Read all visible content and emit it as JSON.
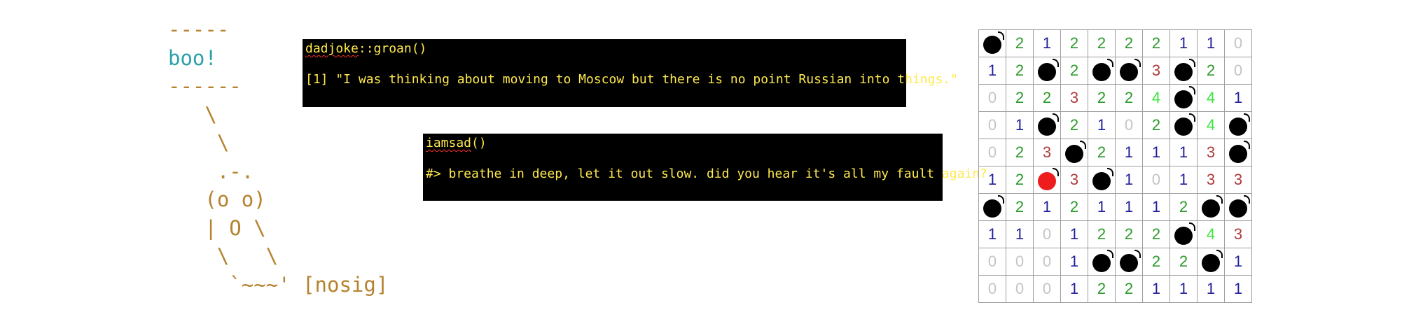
{
  "ascii_art": {
    "top_border": "-----",
    "speech": "boo!",
    "bottom_border": "------",
    "ghost_lines": [
      "   \\",
      "    \\",
      "    .-.",
      "   (o o)",
      "   | O \\",
      "    \\   \\",
      "     `~~~'"
    ],
    "tag": "[nosig]"
  },
  "terminal_1": {
    "command_name": "dadjoke",
    "command_rest": "::groan()",
    "output": "[1] \"I was thinking about moving to Moscow but there is no point Russian into things.\""
  },
  "terminal_2": {
    "command_name": "iamsad",
    "command_rest": "()",
    "output": "#> breathe in deep, let it out slow. did you hear it's all my fault again?"
  },
  "minesweeper": {
    "grid": [
      [
        "B",
        "2",
        "1",
        "2",
        "2",
        "2",
        "2",
        "1",
        "1",
        "0"
      ],
      [
        "1",
        "2",
        "B",
        "2",
        "B",
        "B",
        "3",
        "B",
        "2",
        "0"
      ],
      [
        "0",
        "2",
        "2",
        "3",
        "2",
        "2",
        "4",
        "B",
        "4",
        "1"
      ],
      [
        "0",
        "1",
        "B",
        "2",
        "1",
        "0",
        "2",
        "B",
        "4",
        "B"
      ],
      [
        "0",
        "2",
        "3",
        "B",
        "2",
        "1",
        "1",
        "1",
        "3",
        "B"
      ],
      [
        "1",
        "2",
        "X",
        "3",
        "B",
        "1",
        "0",
        "1",
        "3",
        "3"
      ],
      [
        "B",
        "2",
        "1",
        "2",
        "1",
        "1",
        "1",
        "2",
        "B",
        "B"
      ],
      [
        "1",
        "1",
        "0",
        "1",
        "2",
        "2",
        "2",
        "B",
        "4",
        "3"
      ],
      [
        "0",
        "0",
        "0",
        "1",
        "B",
        "B",
        "2",
        "2",
        "B",
        "1"
      ],
      [
        "0",
        "0",
        "0",
        "1",
        "2",
        "2",
        "1",
        "1",
        "1",
        "1"
      ]
    ],
    "colors": {
      "0": "#c4c4c4",
      "1": "#1f1f99",
      "2": "#2a9a2a",
      "3": "#b03a3a",
      "4": "#3ee63e",
      "exploded": "#ee1c1c"
    }
  }
}
